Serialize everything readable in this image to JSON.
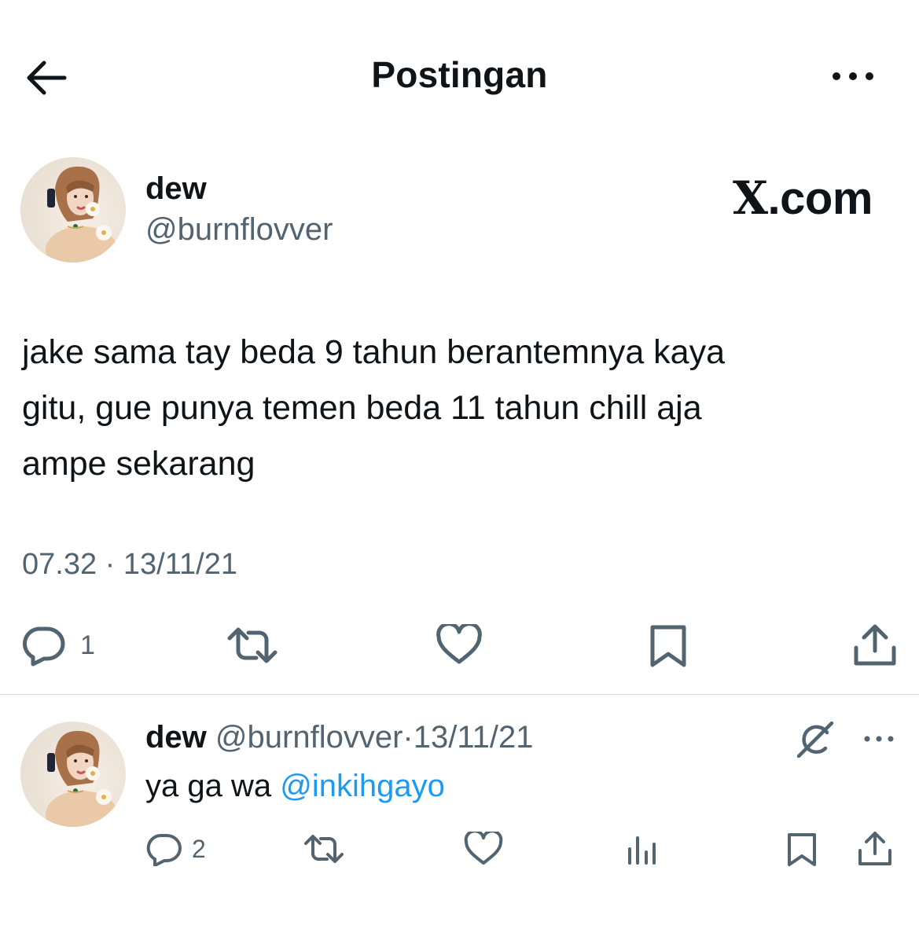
{
  "header": {
    "title": "Postingan"
  },
  "tweet": {
    "author_name": "dew",
    "author_handle": "@burnflovver",
    "watermark_prefix": "X",
    "watermark_suffix": ".com",
    "text_lines": [
      "jake sama tay beda 9 tahun berantemnya kaya",
      "gitu, gue punya temen beda 11 tahun chill aja",
      "ampe sekarang"
    ],
    "meta": "07.32 · 13/11/21",
    "actions": {
      "reply_count": "1"
    }
  },
  "reply": {
    "author_name": "dew",
    "author_handle": "@burnflovver",
    "separator": "·",
    "date": "13/11/21",
    "text": "ya ga wa ",
    "mention": "@inkihgayo",
    "actions": {
      "reply_count": "2"
    }
  },
  "colors": {
    "text": "#0f1419",
    "muted": "#536471",
    "link": "#1d9bf0",
    "divider": "#cfd9de"
  },
  "icons": [
    "back-arrow-icon",
    "more-icon",
    "reply-icon",
    "repost-icon",
    "like-icon",
    "bookmark-icon",
    "share-icon",
    "grok-icon",
    "views-icon"
  ]
}
